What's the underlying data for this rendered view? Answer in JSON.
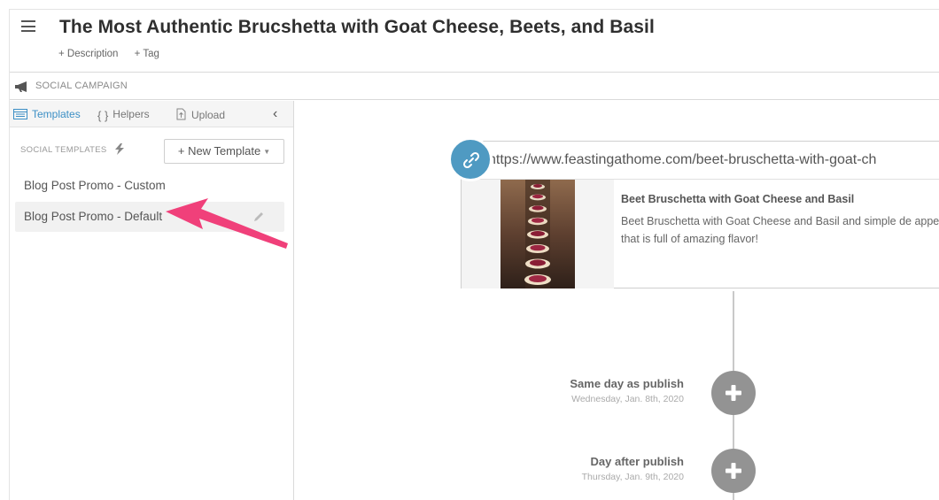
{
  "header": {
    "title": "The Most Authentic Brucshetta with Goat Cheese, Beets, and Basil",
    "add_description": "+ Description",
    "add_tag": "+ Tag"
  },
  "campaign": {
    "label": "SOCIAL CAMPAIGN",
    "icon": "megaphone-icon"
  },
  "sidebar": {
    "tabs": [
      {
        "label": "Templates",
        "icon": "templates-icon",
        "active": true
      },
      {
        "label": "Helpers",
        "icon": "braces-icon",
        "active": false
      },
      {
        "label": "Upload",
        "icon": "upload-icon",
        "active": false
      }
    ],
    "collapse_glyph": "‹",
    "section_label": "SOCIAL TEMPLATES",
    "new_template_label": "+ New Template",
    "templates": [
      {
        "label": "Blog Post Promo - Custom",
        "selected": false
      },
      {
        "label": "Blog Post Promo - Default",
        "selected": true
      }
    ]
  },
  "main": {
    "url": "https://www.feastingathome.com/beet-bruschetta-with-goat-ch",
    "card": {
      "title": "Beet Bruschetta with Goat Cheese and Basil",
      "description": "Beet Bruschetta with Goat Cheese and Basil and simple de appetizer that is full of amazing flavor!"
    },
    "steps": [
      {
        "title": "Same day as publish",
        "date": "Wednesday, Jan. 8th, 2020"
      },
      {
        "title": "Day after publish",
        "date": "Thursday, Jan. 9th, 2020"
      }
    ]
  },
  "colors": {
    "accent": "#3c8fc5",
    "link_badge": "#4f9ac2",
    "plus_button": "#939393",
    "annotation_arrow": "#f0407a"
  }
}
